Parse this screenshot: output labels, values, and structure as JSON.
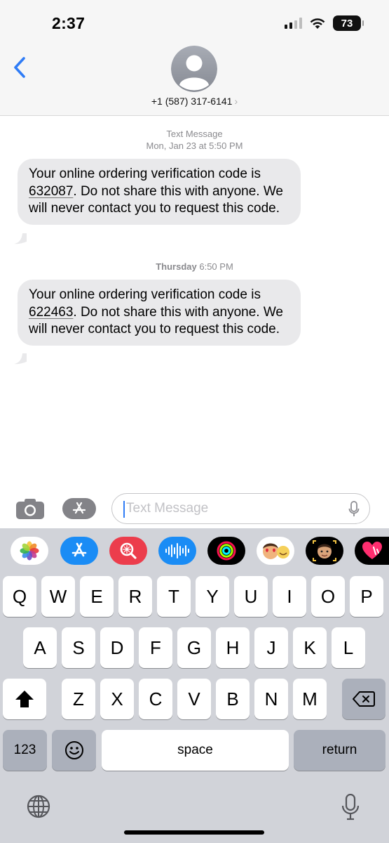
{
  "status_bar": {
    "time": "2:37",
    "battery": "73"
  },
  "contact": {
    "phone": "+1 (587) 317-6141"
  },
  "thread": [
    {
      "header_line1": "Text Message",
      "header_line2": "Mon, Jan 23 at 5:50 PM",
      "text_before": "Your online ordering verification code is ",
      "code": "632087",
      "text_after": ". Do not share this with anyone. We will never contact you to request this code."
    },
    {
      "header_day": "Thursday",
      "header_time": "6:50 PM",
      "text_before": "Your online ordering verification code is ",
      "code": "622463",
      "text_after": ". Do not share this with anyone. We will never contact you to request this code."
    }
  ],
  "composer": {
    "placeholder": "Text Message"
  },
  "app_drawer": [
    "photos-icon",
    "app-store-icon",
    "images-search-icon",
    "audio-message-icon",
    "activity-icon",
    "memoji-stickers-icon",
    "memoji-icon",
    "digital-touch-icon"
  ],
  "keyboard": {
    "row1": [
      "Q",
      "W",
      "E",
      "R",
      "T",
      "Y",
      "U",
      "I",
      "O",
      "P"
    ],
    "row2": [
      "A",
      "S",
      "D",
      "F",
      "G",
      "H",
      "J",
      "K",
      "L"
    ],
    "row3": [
      "Z",
      "X",
      "C",
      "V",
      "B",
      "N",
      "M"
    ],
    "numbers_label": "123",
    "space_label": "space",
    "return_label": "return"
  },
  "colors": {
    "accent": "#2f7cf6",
    "bubble_gray": "#e9e9eb",
    "keyboard_bg": "#d1d3d9"
  }
}
